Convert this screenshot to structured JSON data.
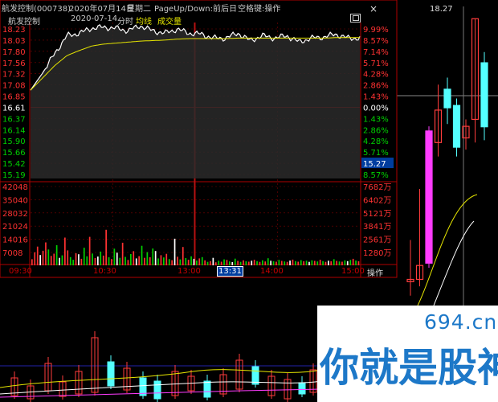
{
  "header": {
    "prefix": "航发控制(000738)",
    "date_long": "2020年07月14日",
    "weekday": "星期二",
    "hint": "PageUp/Down:前后日",
    "hint2": "空格键:操作",
    "stock_name": "航发控制",
    "date_short": "2020-07-14",
    "mode": "分时",
    "avg_label": "均线",
    "vol_label": "成交量",
    "close_symbol": "×"
  },
  "kline": {
    "high_label": "18.27"
  },
  "watermark": {
    "site": "694.cn",
    "slogan": "你就是股神"
  },
  "time_axis": {
    "labels": [
      "09:30",
      "10:30",
      "13:00",
      "14:00",
      "15:00"
    ],
    "active_label": "13:31",
    "op_label": "操作"
  },
  "colors": {
    "up": "#ff3232",
    "down": "#00d000",
    "flat": "#ffffff",
    "price_line": "#ffffff",
    "avg_line": "#e6e600",
    "grid": "#7a0000",
    "cursor_label_bg": "#003d9e",
    "kline_up": "#ff3c3c",
    "kline_down": "#54ffff",
    "kline_magenta": "#ff3cff",
    "watermark": "#1d78c8"
  },
  "chart_data": [
    {
      "type": "line",
      "name": "intraday-price",
      "prev_close": 16.61,
      "ylim": [
        15.07,
        18.15
      ],
      "y_ticks_left": [
        "18.23",
        "18.03",
        "17.80",
        "17.56",
        "17.32",
        "17.08",
        "16.85",
        "16.61",
        "16.37",
        "16.14",
        "15.90",
        "15.66",
        "15.42",
        "15.19"
      ],
      "y_ticks_right": [
        "9.99%",
        "8.57%",
        "7.14%",
        "5.71%",
        "4.28%",
        "2.86%",
        "1.43%",
        "0.00%",
        "1.43%",
        "2.86%",
        "4.28%",
        "5.71%",
        "15.27",
        "8.57%"
      ],
      "current_price_marker": "15.27",
      "x": [
        "09:30",
        "09:35",
        "09:40",
        "09:45",
        "09:50",
        "10:00",
        "10:10",
        "10:20",
        "10:30",
        "10:40",
        "10:50",
        "11:00",
        "11:10",
        "11:20",
        "11:30",
        "13:00",
        "13:10",
        "13:20",
        "13:31",
        "13:40",
        "13:50",
        "14:00",
        "14:10",
        "14:20",
        "14:30",
        "14:40",
        "14:50",
        "15:00"
      ],
      "series": [
        {
          "values": [
            16.85,
            17.2,
            17.6,
            17.95,
            18.0,
            18.1,
            18.12,
            18.1,
            18.05,
            18.15,
            18.05,
            18.0,
            18.08,
            18.0,
            17.98,
            17.9,
            17.9,
            18.0,
            17.85,
            17.95,
            17.9,
            17.95,
            17.82,
            17.9,
            17.92,
            17.98,
            17.9,
            17.9
          ]
        },
        {
          "values": [
            16.85,
            17.1,
            17.35,
            17.55,
            17.65,
            17.74,
            17.78,
            17.8,
            17.82,
            17.84,
            17.85,
            17.86,
            17.88,
            17.89,
            17.89,
            17.89,
            17.89,
            17.9,
            17.9,
            17.9,
            17.9,
            17.9,
            17.9,
            17.9,
            17.9,
            17.91,
            17.91,
            17.91
          ]
        }
      ]
    },
    {
      "type": "bar",
      "name": "intraday-volume",
      "ylim": [
        0,
        42048
      ],
      "y_ticks_left": [
        "42048",
        "35040",
        "28032",
        "21024",
        "14016",
        "7008"
      ],
      "y_ticks_right": [
        "7682万",
        "6402万",
        "5121万",
        "3841万",
        "2561万",
        "1280万"
      ],
      "values": [
        3200,
        6800,
        9800,
        5400,
        7600,
        12000,
        8300,
        4900,
        6100,
        10500,
        3900,
        5200,
        14500,
        7800,
        4300,
        2900,
        6300,
        5800,
        3400,
        9200,
        4700,
        14900,
        6200,
        3800,
        4600,
        7200,
        5100,
        18600,
        4200,
        3300,
        8700,
        6600,
        3900,
        11800,
        4400,
        2800,
        5900,
        7400,
        3600,
        4800,
        10200,
        3900,
        6900,
        4200,
        8800,
        7500,
        3600,
        5300,
        4100,
        6000,
        3300,
        2700,
        13900,
        4500,
        3100,
        9600,
        3800,
        2900,
        4700,
        3400,
        2500,
        3600,
        4300,
        2600,
        1800,
        2200,
        3900,
        1600,
        2400,
        1900,
        3100,
        2800,
        2000,
        1700,
        3500,
        2300,
        1800,
        2600,
        2100,
        1900,
        2400,
        2900,
        2200,
        1800,
        2600,
        2000,
        3700,
        2400,
        2100,
        1900,
        2800,
        2300,
        2000,
        1800,
        2500,
        3000,
        2200,
        1900,
        2700,
        2100,
        2400,
        1800,
        2600,
        2300,
        2000,
        2900,
        2200,
        1800,
        2400,
        2100,
        3200,
        2300,
        2000,
        1900,
        2600,
        2200,
        2800,
        3400,
        2500,
        2100
      ],
      "dirs": [
        "u",
        "u",
        "u",
        "d",
        "u",
        "u",
        "d",
        "u",
        "u",
        "d",
        "u",
        "d",
        "u",
        "u",
        "d",
        "d",
        "u",
        "d",
        "u",
        "d",
        "d",
        "u",
        "d",
        "u",
        "u",
        "d",
        "u",
        "u",
        "d",
        "u",
        "d",
        "u",
        "d",
        "u",
        "d",
        "u",
        "d",
        "u",
        "d",
        "u",
        "d",
        "u",
        "d",
        "u",
        "d",
        "u",
        "d",
        "u",
        "d",
        "u",
        "d",
        "u",
        "d",
        "u",
        "d",
        "u",
        "d",
        "u",
        "d",
        "u",
        "d",
        "u",
        "d",
        "u",
        "d",
        "u",
        "d",
        "u",
        "d",
        "u",
        "d",
        "u",
        "d",
        "u",
        "d",
        "u",
        "d",
        "u",
        "d",
        "u",
        "d",
        "u",
        "d",
        "u",
        "d",
        "u",
        "d",
        "u",
        "d",
        "u",
        "d",
        "u",
        "d",
        "u",
        "d",
        "u",
        "d",
        "u",
        "d",
        "u",
        "d",
        "u",
        "d",
        "u",
        "d",
        "u",
        "d",
        "u",
        "d",
        "u",
        "d",
        "u",
        "d",
        "u",
        "d",
        "u",
        "d",
        "u",
        "d",
        "u"
      ]
    },
    {
      "type": "candlestick",
      "name": "daily-kline",
      "ylim": [
        12.0,
        18.5
      ],
      "candles": [
        {
          "o": 12.6,
          "c": 12.65,
          "h": 13.5,
          "l": 12.3
        },
        {
          "o": 12.65,
          "c": 12.95,
          "h": 14.6,
          "l": 12.5
        },
        {
          "o": 13.0,
          "c": 15.85,
          "h": 15.95,
          "l": 12.9
        },
        {
          "o": 15.6,
          "c": 16.3,
          "h": 16.85,
          "l": 15.3
        },
        {
          "o": 16.75,
          "c": 16.35,
          "h": 17.0,
          "l": 16.0
        },
        {
          "o": 16.4,
          "c": 15.5,
          "h": 16.55,
          "l": 15.3
        },
        {
          "o": 15.7,
          "c": 15.95,
          "h": 16.1,
          "l": 15.45
        },
        {
          "o": 16.1,
          "c": 18.27,
          "h": 18.27,
          "l": 15.6
        },
        {
          "o": 17.32,
          "c": 15.94,
          "h": 17.55,
          "l": 15.65
        }
      ]
    }
  ]
}
